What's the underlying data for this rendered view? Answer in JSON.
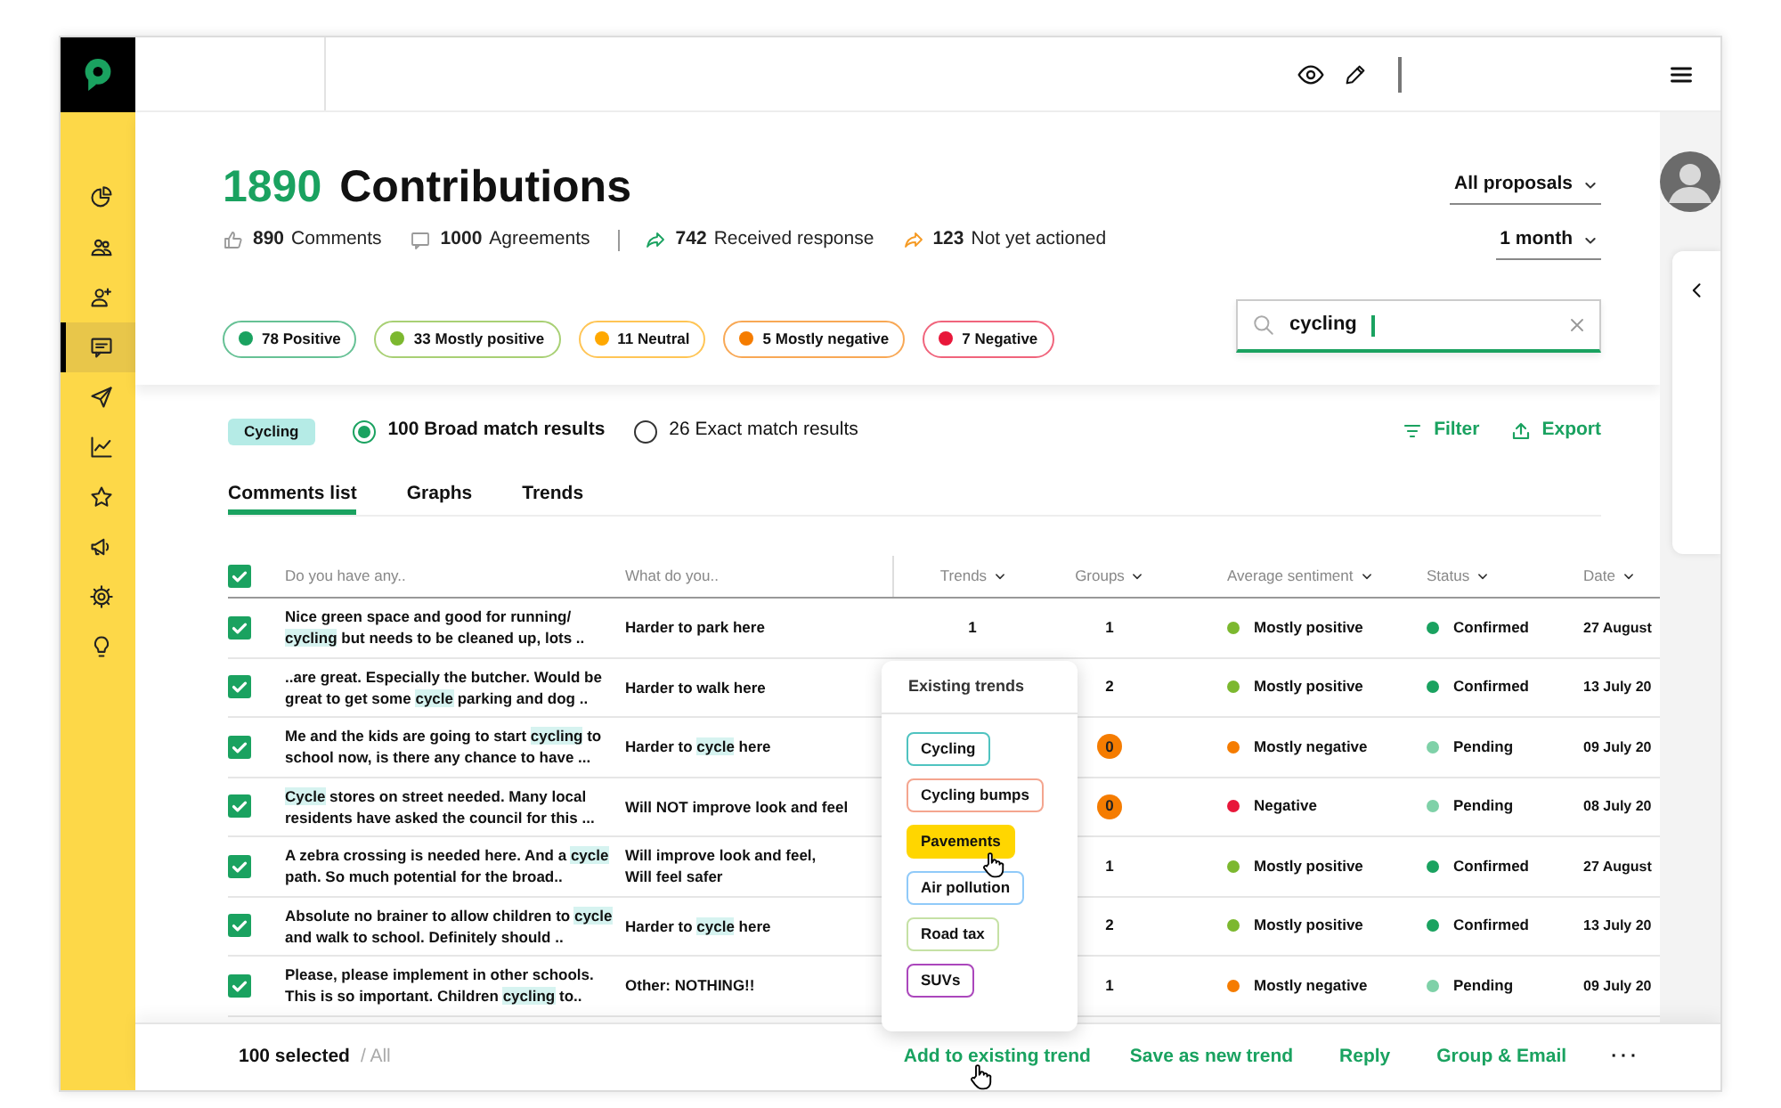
{
  "header": {
    "total": "1890",
    "title": "Contributions",
    "stats": [
      {
        "kind": "likes",
        "value": "890",
        "label": "Comments"
      },
      {
        "kind": "comments",
        "value": "1000",
        "label": "Agreements"
      },
      {
        "kind": "responded",
        "value": "742",
        "label": "Received response"
      },
      {
        "kind": "pending",
        "value": "123",
        "label": "Not yet actioned"
      }
    ],
    "sentiments": [
      {
        "count": "78",
        "label": "Positive",
        "color": "#1aa260"
      },
      {
        "count": "33",
        "label": "Mostly positive",
        "color": "#7cb82f"
      },
      {
        "count": "11",
        "label": "Neutral",
        "color": "#ffa800"
      },
      {
        "count": "5",
        "label": "Mostly negative",
        "color": "#f57c00"
      },
      {
        "count": "7",
        "label": "Negative",
        "color": "#e8173a"
      }
    ],
    "dropdowns": [
      {
        "label": "All proposals"
      },
      {
        "label": "1 month"
      }
    ],
    "search": {
      "value": "cycling"
    }
  },
  "sidebar": {
    "items": [
      {
        "selected": false
      },
      {
        "selected": false
      },
      {
        "selected": false
      },
      {
        "selected": true
      },
      {
        "selected": false
      },
      {
        "selected": false
      },
      {
        "selected": false
      },
      {
        "selected": false
      },
      {
        "selected": false
      },
      {
        "selected": false
      }
    ]
  },
  "search_tag": "Cycling",
  "match_options": [
    {
      "label": "100 Broad match results",
      "selected": true
    },
    {
      "label": "26 Exact match results",
      "selected": false
    }
  ],
  "toolbar": [
    "Filter",
    "Export"
  ],
  "tabs": [
    {
      "label": "Comments list",
      "selected": true
    },
    {
      "label": "Graphs",
      "selected": false
    },
    {
      "label": "Trends",
      "selected": false
    }
  ],
  "table": {
    "all_checked": true,
    "columns": [
      {
        "label": "Do you have any..",
        "sortable": false
      },
      {
        "label": "What do you..",
        "sortable": false
      },
      {
        "label": "Trends",
        "sortable": true
      },
      {
        "label": "Groups",
        "sortable": true
      },
      {
        "label": "Average sentiment",
        "sortable": true
      },
      {
        "label": "Status",
        "sortable": true
      },
      {
        "label": "Date",
        "sortable": true
      }
    ],
    "rows": [
      {
        "checked": true,
        "comment": [
          {
            "text": "Nice green space and good for running/ ",
            "highlight": false
          },
          {
            "text": "cycling",
            "highlight": true
          },
          {
            "text": " but needs to be cleaned up, lots ..",
            "highlight": false
          }
        ],
        "answer": [
          {
            "text": "Harder to park here",
            "highlight": false
          }
        ],
        "trends": "1",
        "groups": "1",
        "groups_flag": false,
        "sentiment": {
          "label": "Mostly positive",
          "color": "#7cb82f"
        },
        "status": {
          "label": "Confirmed",
          "color": "#1aa260"
        },
        "date": "27 August"
      },
      {
        "checked": true,
        "comment": [
          {
            "text": "..are great. Especially the butcher. Would be great to get some ",
            "highlight": false
          },
          {
            "text": "cycle",
            "highlight": true
          },
          {
            "text": " parking and dog ..",
            "highlight": false
          }
        ],
        "answer": [
          {
            "text": "Harder to walk here",
            "highlight": false
          }
        ],
        "groups": "2",
        "groups_flag": false,
        "sentiment": {
          "label": "Mostly positive",
          "color": "#7cb82f"
        },
        "status": {
          "label": "Confirmed",
          "color": "#1aa260"
        },
        "date": "13 July 20"
      },
      {
        "checked": true,
        "comment": [
          {
            "text": "Me and the kids are going to start ",
            "highlight": false
          },
          {
            "text": "cycling",
            "highlight": true
          },
          {
            "text": " to school now, is there any chance to have ...",
            "highlight": false
          }
        ],
        "answer": [
          {
            "text": "Harder to ",
            "highlight": false
          },
          {
            "text": "cycle",
            "highlight": true
          },
          {
            "text": " here",
            "highlight": false
          }
        ],
        "groups": "0",
        "groups_flag": true,
        "sentiment": {
          "label": "Mostly negative",
          "color": "#f57c00"
        },
        "status": {
          "label": "Pending",
          "color": "#7fd1a8"
        },
        "date": "09 July 20"
      },
      {
        "checked": true,
        "comment": [
          {
            "text": "Cycle",
            "highlight": true
          },
          {
            "text": " stores on street needed. Many local residents have asked the council for this ...",
            "highlight": false
          }
        ],
        "answer": [
          {
            "text": "Will NOT improve look and feel",
            "highlight": false
          }
        ],
        "groups": "0",
        "groups_flag": true,
        "sentiment": {
          "label": "Negative",
          "color": "#e8173a"
        },
        "status": {
          "label": "Pending",
          "color": "#7fd1a8"
        },
        "date": "08 July 20"
      },
      {
        "checked": true,
        "comment": [
          {
            "text": "A zebra crossing is needed here. And a ",
            "highlight": false
          },
          {
            "text": "cycle",
            "highlight": true
          },
          {
            "text": " path. So much potential for the broad..",
            "highlight": false
          }
        ],
        "answer": [
          {
            "text": "Will improve look and feel,\nWill feel safer",
            "highlight": false
          }
        ],
        "groups": "1",
        "groups_flag": false,
        "sentiment": {
          "label": "Mostly positive",
          "color": "#7cb82f"
        },
        "status": {
          "label": "Confirmed",
          "color": "#1aa260"
        },
        "date": "27 August"
      },
      {
        "checked": true,
        "comment": [
          {
            "text": "Absolute no brainer to allow children to ",
            "highlight": false
          },
          {
            "text": "cycle",
            "highlight": true
          },
          {
            "text": " and walk to school. Definitely should ..",
            "highlight": false
          }
        ],
        "answer": [
          {
            "text": "Harder to ",
            "highlight": false
          },
          {
            "text": "cycle",
            "highlight": true
          },
          {
            "text": " here",
            "highlight": false
          }
        ],
        "groups": "2",
        "groups_flag": false,
        "sentiment": {
          "label": "Mostly positive",
          "color": "#7cb82f"
        },
        "status": {
          "label": "Confirmed",
          "color": "#1aa260"
        },
        "date": "13 July 20"
      },
      {
        "checked": true,
        "comment": [
          {
            "text": "Please, please implement in other schools. This is so important. Children ",
            "highlight": false
          },
          {
            "text": "cycling",
            "highlight": true
          },
          {
            "text": " to..",
            "highlight": false
          }
        ],
        "answer": [
          {
            "text": "Other: NOTHING!!",
            "highlight": false
          }
        ],
        "groups": "1",
        "groups_flag": false,
        "sentiment": {
          "label": "Mostly negative",
          "color": "#f57c00"
        },
        "status": {
          "label": "Pending",
          "color": "#7fd1a8"
        },
        "date": "09 July 20"
      }
    ]
  },
  "trends_popup": {
    "title": "Existing trends",
    "items": [
      {
        "label": "Cycling",
        "color": "#4fc3c0",
        "selected": false
      },
      {
        "label": "Cycling bumps",
        "color": "#f4a58f",
        "selected": false
      },
      {
        "label": "Pavements",
        "color": "#ffd600",
        "selected": true
      },
      {
        "label": "Air pollution",
        "color": "#90caf9",
        "selected": false
      },
      {
        "label": "Road tax",
        "color": "#c5e1a5",
        "selected": false
      },
      {
        "label": "SUVs",
        "color": "#ab47bc",
        "selected": false
      }
    ]
  },
  "footer": {
    "selected": "100 selected",
    "scope": "/ All",
    "actions": [
      "Add to existing trend",
      "Save as new trend",
      "Reply",
      "Group & Email",
      "···"
    ]
  }
}
